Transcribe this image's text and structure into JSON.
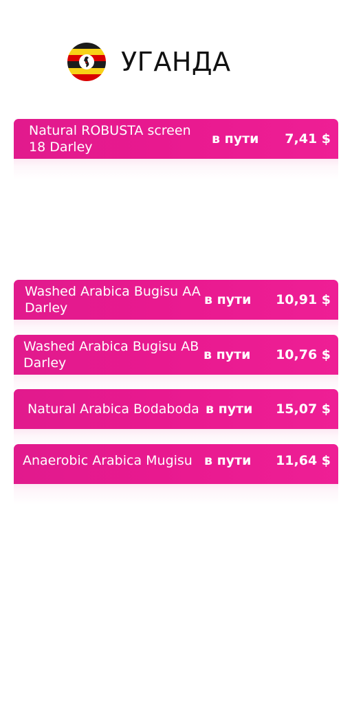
{
  "header": {
    "country": "УГАНДА",
    "flag_icon": "uganda-flag-icon",
    "flag_colors": [
      "#1c1c1c",
      "#f7d117",
      "#d90000"
    ]
  },
  "products": [
    {
      "name": "Natural ROBUSTA screen 18 Darley",
      "status": "в пути",
      "price": "7,41 $"
    },
    {
      "name": "Washed Arabica Bugisu AA Darley",
      "status": "в пути",
      "price": "10,91 $"
    },
    {
      "name": "Washed Arabica Bugisu AB Darley",
      "status": "в пути",
      "price": "10,76 $"
    },
    {
      "name": "Natural Arabica Bodaboda",
      "status": "в пути",
      "price": "15,07 $"
    },
    {
      "name": "Anaerobic Arabica Mugisu",
      "status": "в пути",
      "price": "11,64 $"
    }
  ],
  "colors": {
    "accent": "#e8198f",
    "text_on_accent": "#ffffff",
    "title": "#111111"
  }
}
